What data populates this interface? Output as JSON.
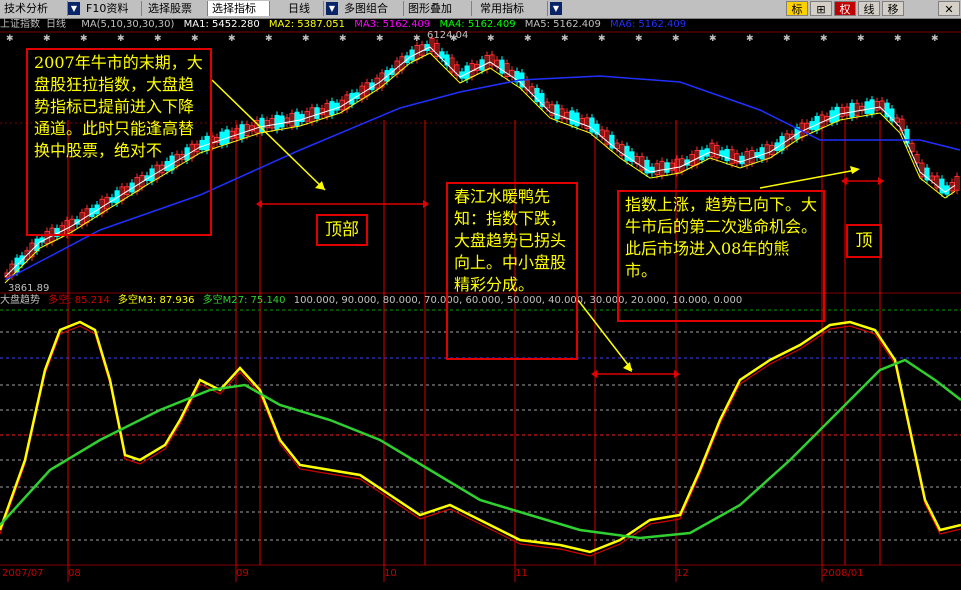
{
  "toolbar": {
    "tabs": [
      {
        "label": "技术分析",
        "active": false
      },
      {
        "label": "F10资料",
        "active": false
      },
      {
        "label": "选择股票",
        "active": false
      },
      {
        "label": "选择指标",
        "active": true
      },
      {
        "label": "日线",
        "active": false
      },
      {
        "label": "多图组合",
        "active": false
      },
      {
        "label": "图形叠加",
        "active": false
      },
      {
        "label": "常用指标",
        "active": false
      }
    ],
    "right_buttons": [
      "标",
      "⊞",
      "权",
      "线",
      "移"
    ]
  },
  "ma_bar": {
    "title": "上证指数",
    "period": "日线",
    "ma_params": "MA(5,10,30,30,30)",
    "ma1": "MA1: 5452.280",
    "ma2": "MA2: 5387.051",
    "ma3": "MA3: 5162.409",
    "ma4": "MA4: 5162.409",
    "ma5": "MA5: 5162.409",
    "ma6": "MA6: 5162.409"
  },
  "price_labels": {
    "high": "6124.04",
    "low": "3861.89"
  },
  "indicator_bar": {
    "name": "大盘趋势",
    "v1": "多空: 85.214",
    "v2": "多空M3: 87.936",
    "v3": "多空M27: 75.140",
    "levels": "100.000, 90.000, 80.000, 70.000, 60.000, 50.000, 40.000, 30.000, 20.000, 10.000, 0.000"
  },
  "dates": [
    "2007/07",
    "08",
    "09",
    "10",
    "11",
    "12",
    "2008/01"
  ],
  "annotations": {
    "a1": "2007年牛市的末期，大盘股狂拉指数，大盘趋势指标已提前进入下降通道。此时只能逢高替换中股票，绝对不",
    "a2": "春江水暖鸭先知：指数下跌，大盘趋势已拐头向上。中小盘股精彩分成。",
    "a3": "指数上涨，趋势已向下。大牛市后的第二次逃命机会。此后市场进入08年的熊市。",
    "top1": "顶部",
    "top2": "顶"
  },
  "colors": {
    "ma_white": "#ffffff",
    "ma_yellow": "#ffff00",
    "ma_blue": "#2030ff",
    "up_candle": "#ff3030",
    "down_candle": "#00ffff",
    "ind_red": "#d00000",
    "ind_yellow": "#ffff00",
    "ind_green": "#30d030",
    "annot_border": "#e00000",
    "annot_text": "#ffff00"
  }
}
